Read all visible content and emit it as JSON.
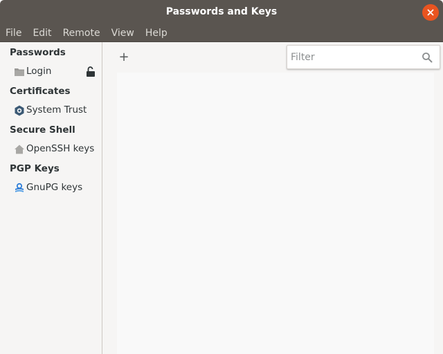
{
  "window": {
    "title": "Passwords and Keys"
  },
  "menu": [
    "File",
    "Edit",
    "Remote",
    "View",
    "Help"
  ],
  "sidebar": {
    "groups": [
      {
        "header": "Passwords",
        "item": {
          "label": "Login",
          "icon": "folder-icon",
          "locked": true
        }
      },
      {
        "header": "Certificates",
        "item": {
          "label": "System Trust",
          "icon": "gear-icon"
        }
      },
      {
        "header": "Secure Shell",
        "item": {
          "label": "OpenSSH keys",
          "icon": "home-icon"
        }
      },
      {
        "header": "PGP Keys",
        "item": {
          "label": "GnuPG keys",
          "icon": "key-icon"
        }
      }
    ]
  },
  "toolbar": {
    "add_label": "+"
  },
  "filter": {
    "placeholder": "Filter",
    "value": ""
  },
  "colors": {
    "titlebar": "#5a5550",
    "close": "#e95420",
    "accent": "#2f7ed8"
  }
}
